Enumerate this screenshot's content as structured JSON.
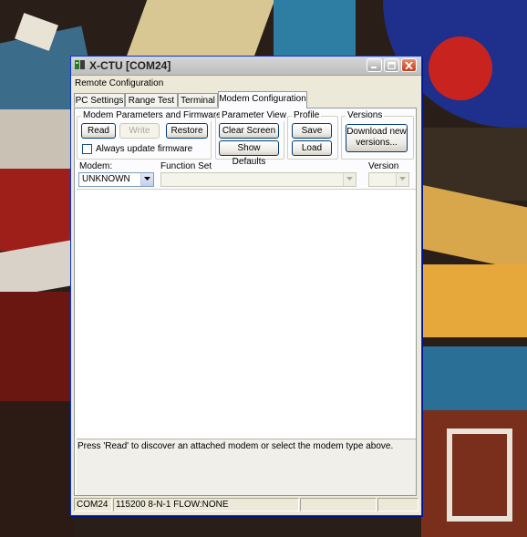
{
  "window": {
    "title": "X-CTU  [COM24]",
    "accent": "#0831d9",
    "close_color": "#c43c16"
  },
  "remote_config_label": "Remote Configuration",
  "tabs": [
    {
      "label": "PC Settings",
      "active": false
    },
    {
      "label": "Range Test",
      "active": false
    },
    {
      "label": "Terminal",
      "active": false
    },
    {
      "label": "Modem Configuration",
      "active": true
    }
  ],
  "groups": {
    "modem_params": {
      "title": "Modem Parameters and Firmware",
      "read": "Read",
      "write": "Write",
      "restore": "Restore",
      "always_update": "Always update firmware",
      "always_update_checked": false
    },
    "param_view": {
      "title": "Parameter View",
      "clear_screen": "Clear Screen",
      "show_defaults": "Show Defaults"
    },
    "profile": {
      "title": "Profile",
      "save": "Save",
      "load": "Load"
    },
    "versions": {
      "title": "Versions",
      "download": "Download new versions..."
    }
  },
  "selectors": {
    "modem_label": "Modem:",
    "modem_value": "UNKNOWN",
    "function_set_label": "Function Set",
    "function_set_value": "",
    "version_label": "Version",
    "version_value": ""
  },
  "hint_text": "Press 'Read' to discover an attached modem or select the modem type above.",
  "status": {
    "port": "COM24",
    "settings": "115200 8-N-1  FLOW:NONE",
    "extra1": "",
    "extra2": ""
  },
  "icons": [
    "xctu-app-icon",
    "minimize-icon",
    "maximize-icon",
    "close-icon",
    "dropdown-arrow-icon"
  ]
}
